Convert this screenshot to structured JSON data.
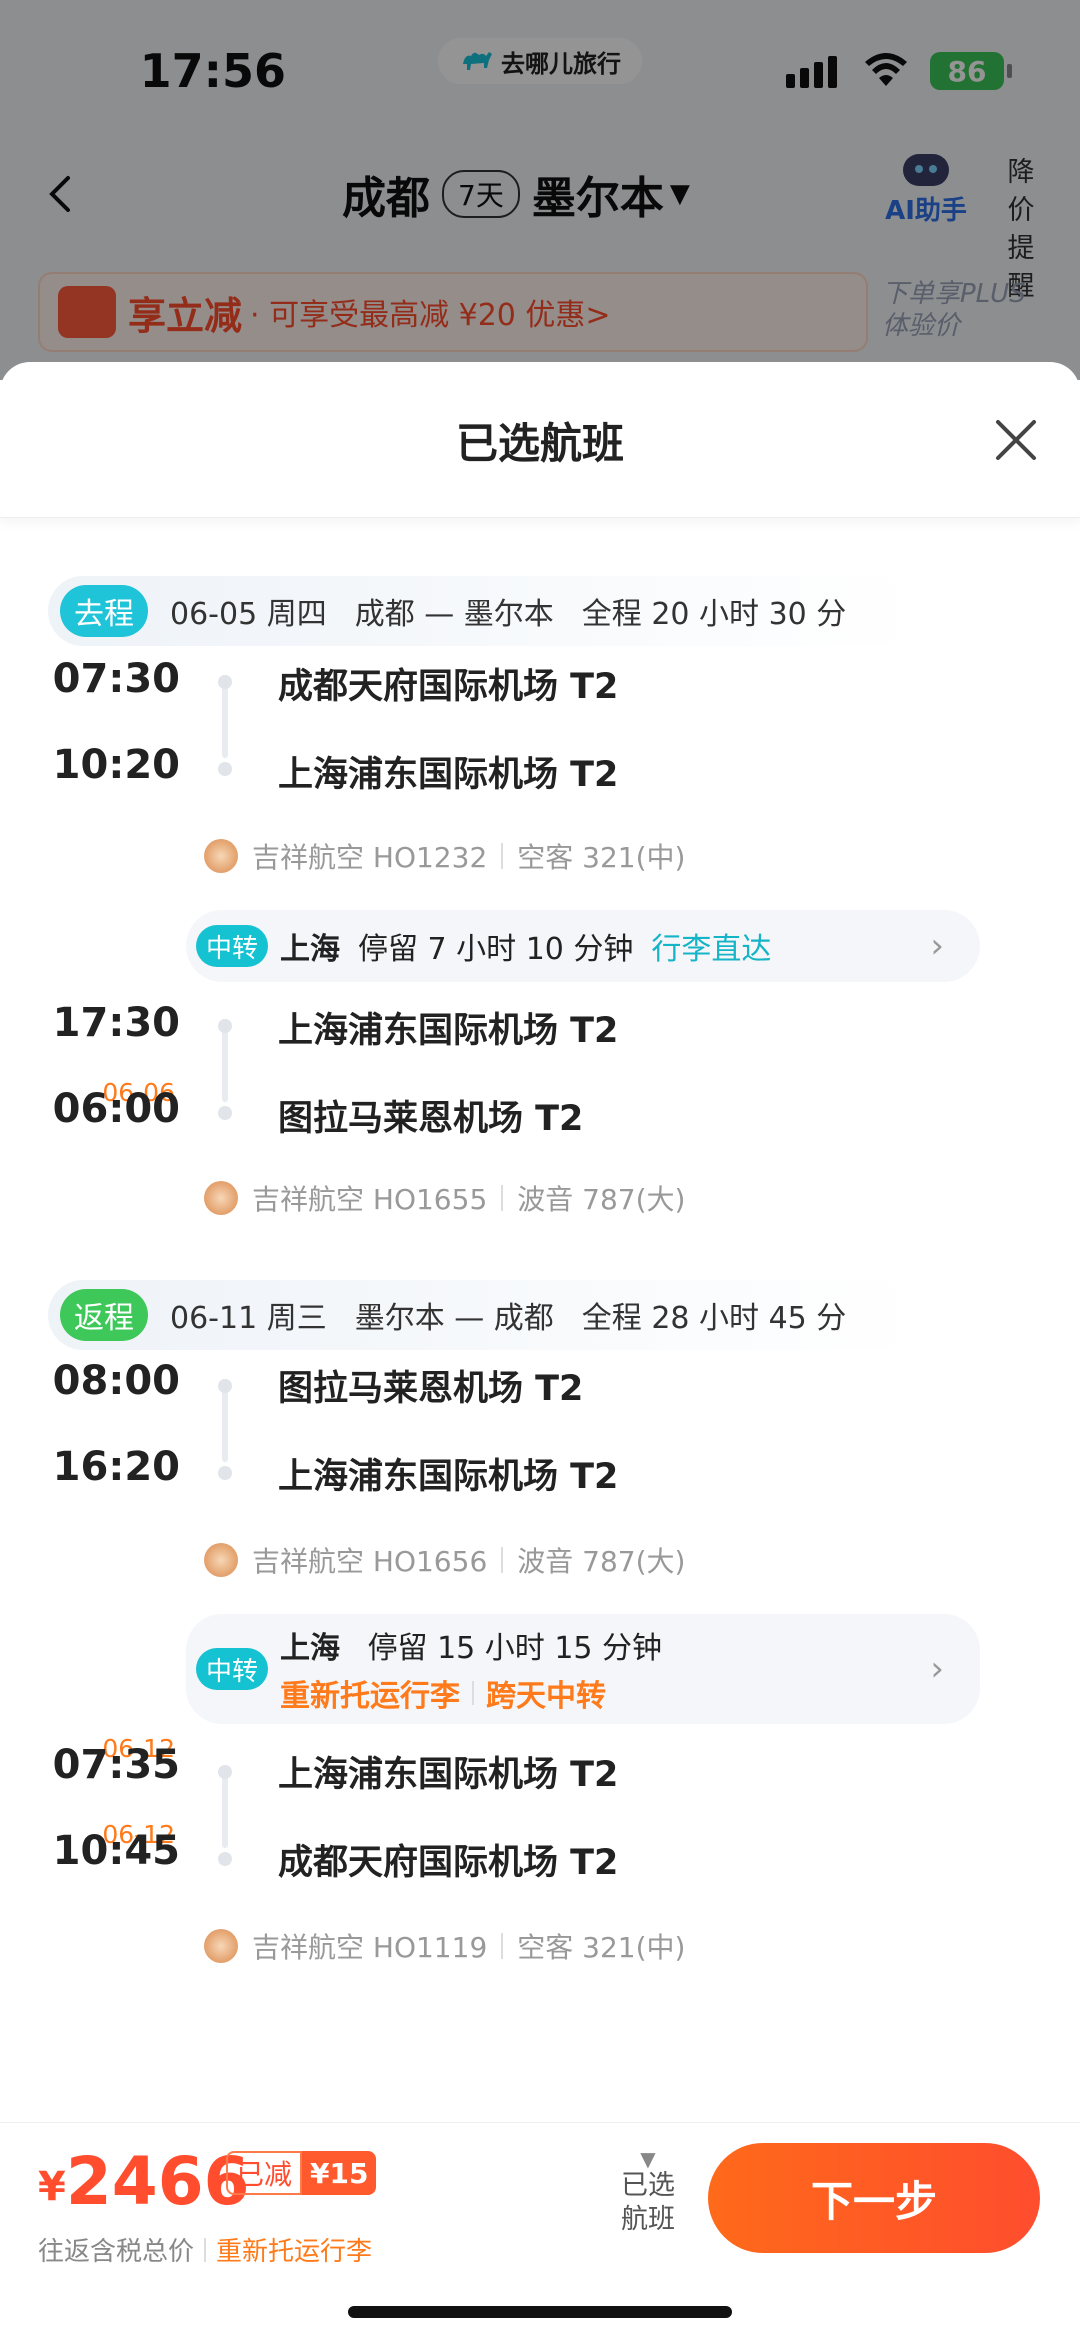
{
  "status_bar": {
    "time": "17:56",
    "app_pill": "去哪儿旅行",
    "battery": "86"
  },
  "nav": {
    "from": "成都",
    "days": "7天",
    "to": "墨尔本",
    "ai_label": "AI助手",
    "price_alert": "降价提醒"
  },
  "promo": {
    "title": "享立减",
    "text": "· 可享受最高减 ¥20 优惠>",
    "plus_text": "下单享PLUS体验价"
  },
  "sheet": {
    "title": "已选航班"
  },
  "outbound": {
    "tag": "去程",
    "date": "06-05 周四",
    "route": "成都 — 墨尔本",
    "duration": "全程 20 小时 30 分",
    "seg1": {
      "dep_time": "07:30",
      "dep_airport": "成都天府国际机场 T2",
      "arr_time": "10:20",
      "arr_airport": "上海浦东国际机场 T2",
      "airline": "吉祥航空 HO1232",
      "aircraft": "空客 321(中)"
    },
    "transfer": {
      "tag": "中转",
      "city": "上海",
      "stay": "停留 7 小时 10 分钟",
      "note": "行李直达"
    },
    "seg2": {
      "dep_time": "17:30",
      "arr_date": "06-06",
      "arr_time": "06:00",
      "dep_airport": "上海浦东国际机场 T2",
      "arr_airport": "图拉马莱恩机场 T2",
      "airline": "吉祥航空 HO1655",
      "aircraft": "波音 787(大)"
    }
  },
  "return": {
    "tag": "返程",
    "date": "06-11 周三",
    "route": "墨尔本 — 成都",
    "duration": "全程 28 小时 45 分",
    "seg1": {
      "dep_time": "08:00",
      "dep_airport": "图拉马莱恩机场 T2",
      "arr_time": "16:20",
      "arr_airport": "上海浦东国际机场 T2",
      "airline": "吉祥航空 HO1656",
      "aircraft": "波音 787(大)"
    },
    "transfer": {
      "tag": "中转",
      "city": "上海",
      "stay": "停留 15 小时 15 分钟",
      "note1": "重新托运行李",
      "note2": "跨天中转"
    },
    "seg2": {
      "dep_date": "06-12",
      "dep_time": "07:35",
      "arr_date": "06-12",
      "arr_time": "10:45",
      "dep_airport": "上海浦东国际机场 T2",
      "arr_airport": "成都天府国际机场 T2",
      "airline": "吉祥航空 HO1119",
      "aircraft": "空客 321(中)"
    }
  },
  "footer": {
    "currency": "¥",
    "price": "2466",
    "saved_label": "已减",
    "saved_amount": "¥15",
    "price_note": "往返含税总价",
    "baggage_note": "重新托运行李",
    "selected_label": "已选航班",
    "next_button": "下一步"
  },
  "colors": {
    "accent": "#ff4d2e",
    "transfer_tag": "#15c2d2",
    "outbound_tag": "#20c4d8",
    "return_tag": "#3fc85a",
    "date_orange": "#ff7a1a"
  }
}
